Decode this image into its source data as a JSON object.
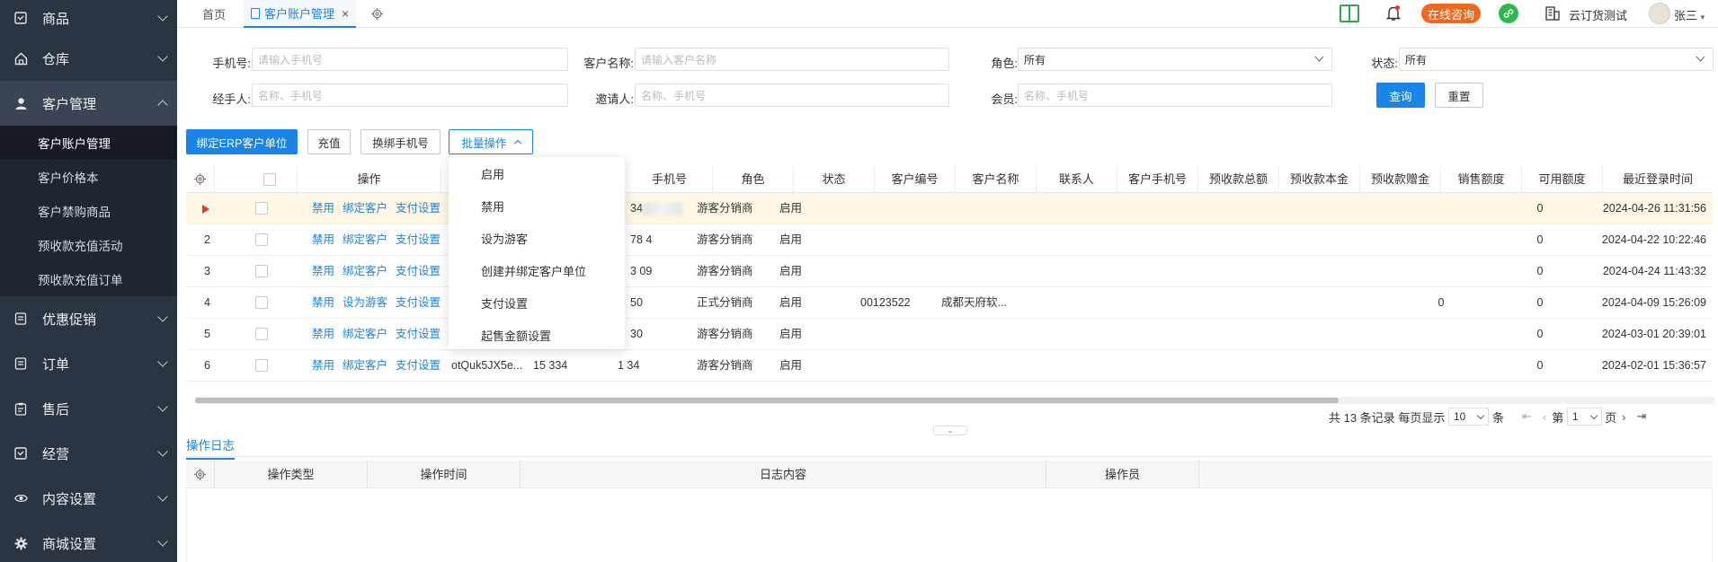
{
  "sidebar": {
    "items": [
      {
        "label": "商品",
        "icon": "box-check-icon"
      },
      {
        "label": "仓库",
        "icon": "home-icon"
      },
      {
        "label": "客户管理",
        "icon": "user-icon"
      },
      {
        "label": "优惠促销",
        "icon": "list-icon"
      },
      {
        "label": "订单",
        "icon": "list-icon"
      },
      {
        "label": "售后",
        "icon": "clipboard-icon"
      },
      {
        "label": "经营",
        "icon": "box-check-icon"
      },
      {
        "label": "内容设置",
        "icon": "eye-icon"
      },
      {
        "label": "商城设置",
        "icon": "gear-icon"
      }
    ],
    "sub_items": [
      {
        "label": "客户账户管理",
        "active": true
      },
      {
        "label": "客户价格本"
      },
      {
        "label": "客户禁购商品"
      },
      {
        "label": "预收款充值活动"
      },
      {
        "label": "预收款充值订单"
      }
    ]
  },
  "tabs": {
    "home": "首页",
    "active": "客户账户管理",
    "close": "×"
  },
  "topbar": {
    "consult": "在线咨询",
    "company": "云订货测试",
    "user": "张三",
    "colors": {
      "consult_bg": "#f2681c",
      "wechat": "#2db84c",
      "book": "#2fa84f"
    }
  },
  "filters": {
    "phone_label": "手机号:",
    "phone_placeholder": "请输入手机号",
    "name_label": "客户名称:",
    "name_placeholder": "请输入客户名称",
    "role_label": "角色:",
    "role_value": "所有",
    "status_label": "状态:",
    "status_value": "所有",
    "handler_label": "经手人:",
    "handler_placeholder": "名称、手机号",
    "inviter_label": "邀请人:",
    "inviter_placeholder": "名称、手机号",
    "member_label": "会员:",
    "member_placeholder": "名称、手机号",
    "query": "查询",
    "reset": "重置"
  },
  "toolbar": {
    "bind_erp": "绑定ERP客户单位",
    "recharge": "充值",
    "change_phone": "换绑手机号",
    "batch": "批量操作"
  },
  "batch_menu": [
    "启用",
    "禁用",
    "设为游客",
    "创建并绑定客户单位",
    "支付设置",
    "起售金额设置"
  ],
  "table": {
    "columns": [
      "操作",
      "手机号",
      "角色",
      "状态",
      "客户编号",
      "客户名称",
      "联系人",
      "客户手机号",
      "预收款总额",
      "预收款本金",
      "预收款赠金",
      "销售额度",
      "可用额度",
      "最近登录时间"
    ],
    "rows": [
      {
        "idx": "",
        "actions": [
          "禁用",
          "绑定客户",
          "支付设置"
        ],
        "openid": "",
        "phone_a": "",
        "phone": "34",
        "role": "游客分销商",
        "status": "启用",
        "code": "",
        "name": "",
        "total": "",
        "quota": "0",
        "time": "2024-04-26 11:31:56"
      },
      {
        "idx": "2",
        "actions": [
          "禁用",
          "绑定客户",
          "支付设置"
        ],
        "openid": "",
        "phone_a": "",
        "phone": "78 4",
        "role": "游客分销商",
        "status": "启用",
        "code": "",
        "name": "",
        "total": "",
        "quota": "0",
        "time": "2024-04-22 10:22:46"
      },
      {
        "idx": "3",
        "actions": [
          "禁用",
          "绑定客户",
          "支付设置"
        ],
        "openid": "",
        "phone_a": "",
        "phone": "3 09",
        "role": "游客分销商",
        "status": "启用",
        "code": "",
        "name": "",
        "total": "",
        "quota": "0",
        "time": "2024-04-24 11:43:32"
      },
      {
        "idx": "4",
        "actions": [
          "禁用",
          "设为游客",
          "支付设置"
        ],
        "openid": "",
        "phone_a": "",
        "phone": "50",
        "role": "正式分销商",
        "status": "启用",
        "code": "00123522",
        "name": "成都天府软...",
        "total": "0",
        "quota": "0",
        "time": "2024-04-09 15:26:09"
      },
      {
        "idx": "5",
        "actions": [
          "禁用",
          "绑定客户",
          "支付设置"
        ],
        "openid": "",
        "phone_a": "",
        "phone": "30",
        "role": "游客分销商",
        "status": "启用",
        "code": "",
        "name": "",
        "total": "",
        "quota": "0",
        "time": "2024-03-01 20:39:01"
      },
      {
        "idx": "6",
        "actions": [
          "禁用",
          "绑定客户",
          "支付设置"
        ],
        "openid": "otQuk5JX5e...",
        "phone_a": "15 334",
        "phone": "1 34",
        "role": "游客分销商",
        "status": "启用",
        "code": "",
        "name": "",
        "total": "",
        "quota": "0",
        "time": "2024-02-01 15:36:57"
      }
    ]
  },
  "pager": {
    "total": "共 13 条记录",
    "per_page_label": "每页显示",
    "per_page": "10",
    "unit": "条",
    "page_prefix": "第",
    "page": "1",
    "page_suffix": "页"
  },
  "log": {
    "tab": "操作日志",
    "columns": [
      "操作类型",
      "操作时间",
      "日志内容",
      "操作员"
    ]
  }
}
